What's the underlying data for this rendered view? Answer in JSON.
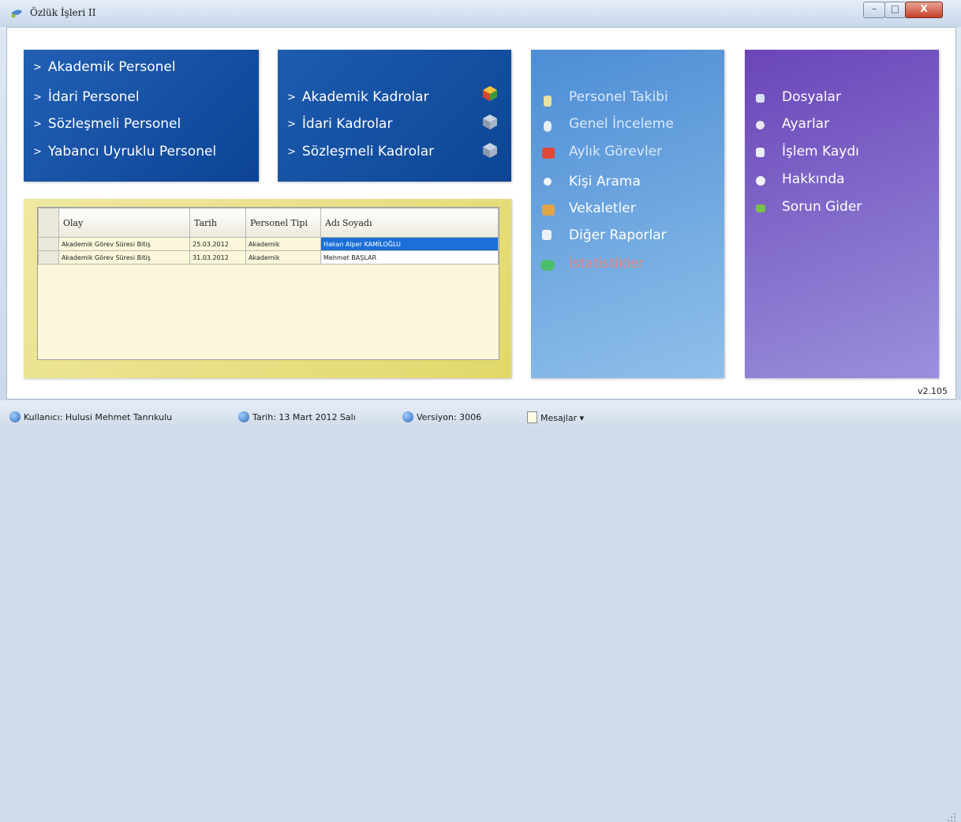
{
  "window": {
    "title": "Özlük İşleri II",
    "min_label": "–",
    "max_label": "□",
    "close_label": "X"
  },
  "personel_menu": {
    "items": [
      "Akademik Personel",
      "İdari Personel",
      "Sözleşmeli Personel",
      "Yabancı Uyruklu Personel"
    ]
  },
  "kadro_menu": {
    "items": [
      "Akademik Kadrolar",
      "İdari Kadrolar",
      "Sözleşmeli Kadrolar"
    ]
  },
  "tools_menu": {
    "items": [
      "Personel Takibi",
      "Genel İnceleme",
      "Aylık Görevler",
      "Kişi Arama",
      "Vekaletler",
      "Diğer Raporlar",
      "İstatistikler"
    ]
  },
  "system_menu": {
    "items": [
      "Dosyalar",
      "Ayarlar",
      "İşlem Kaydı",
      "Hakkında",
      "Sorun Gider"
    ]
  },
  "events_table": {
    "columns": [
      "Olay",
      "Tarih",
      "Personel Tipi",
      "Adı Soyadı"
    ],
    "rows": [
      {
        "olay": "Akademik Görev Süresi Bitiş",
        "tarih": "25.03.2012",
        "tip": "Akademik",
        "ad": "Hakan Alper KAMİLOĞLU"
      },
      {
        "olay": "Akademik Görev Süresi Bitiş",
        "tarih": "31.03.2012",
        "tip": "Akademik",
        "ad": "Mehmet BAŞLAR"
      }
    ]
  },
  "version": "v2.105",
  "statusbar": {
    "user": "Kullanıcı: Hulusi Mehmet Tanrıkulu",
    "date": "Tarih: 13 Mart 2012 Salı",
    "build": "Versiyon: 3006",
    "messages": "Mesajlar ▾"
  },
  "colors": {
    "personel_panel": "#1553a8",
    "tools_panel": "#6aa7e2",
    "system_panel": "#7a62c8",
    "selected_row": "#1c6fd6",
    "disabled_item": "#e8867e"
  }
}
